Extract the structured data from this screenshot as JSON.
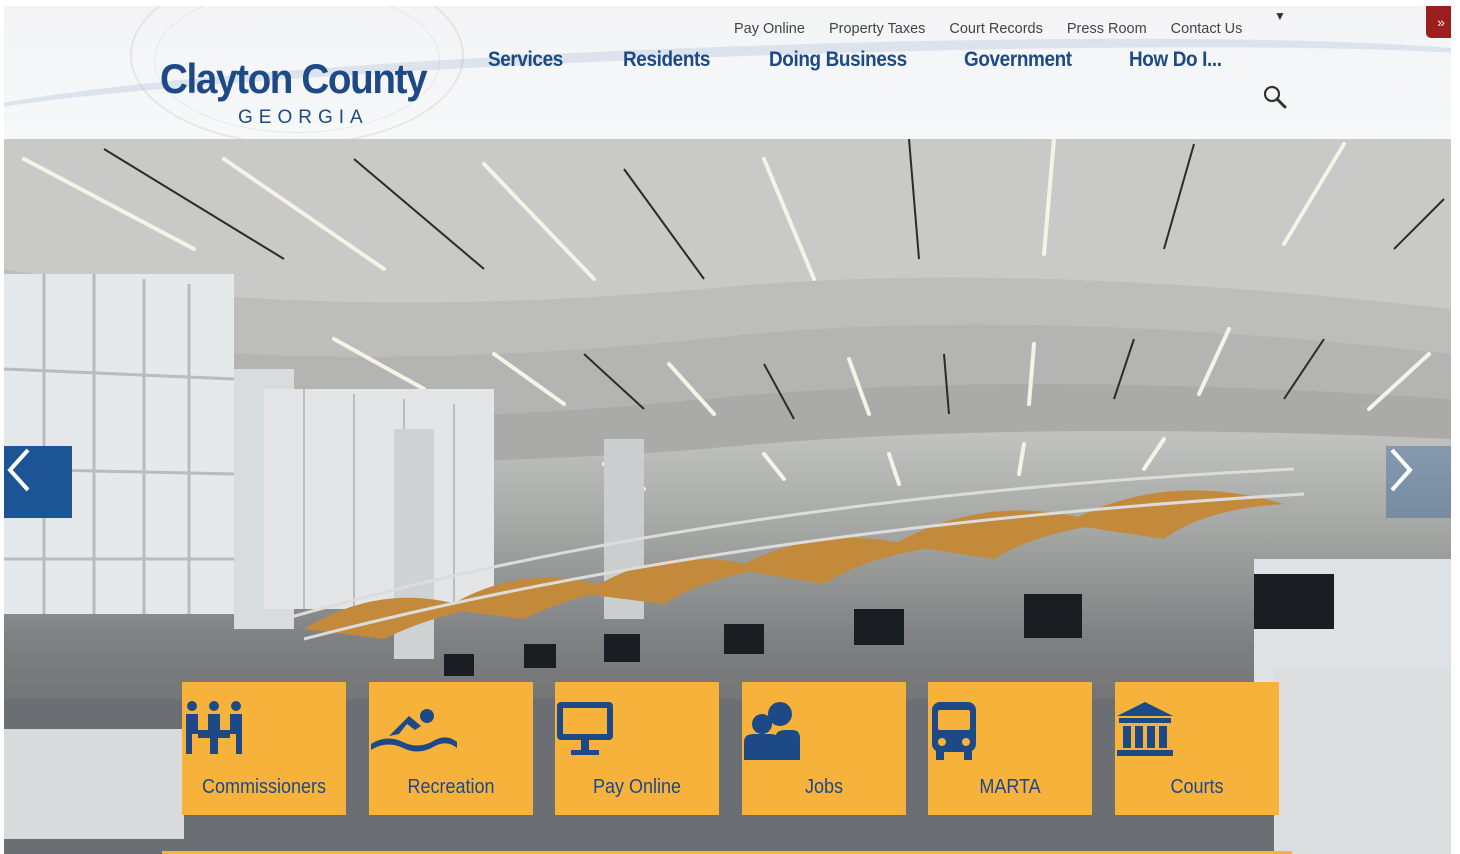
{
  "header": {
    "logo_title": "Clayton County",
    "logo_subtitle": "GEORGIA",
    "utility_links": [
      "Pay Online",
      "Property Taxes",
      "Court Records",
      "Press Room",
      "Contact Us"
    ],
    "main_nav": [
      "Services",
      "Residents",
      "Doing Business",
      "Government",
      "How Do I..."
    ]
  },
  "quick_links": [
    {
      "label": "Commissioners",
      "icon": "meeting-table-icon"
    },
    {
      "label": "Recreation",
      "icon": "swimmer-icon"
    },
    {
      "label": "Pay Online",
      "icon": "monitor-icon"
    },
    {
      "label": "Jobs",
      "icon": "people-icon"
    },
    {
      "label": "MARTA",
      "icon": "bus-icon"
    },
    {
      "label": "Courts",
      "icon": "courthouse-icon"
    }
  ],
  "colors": {
    "brand_blue": "#1d4a86",
    "tile_yellow": "#f7b23b",
    "alert_red": "#9c1f1f"
  }
}
